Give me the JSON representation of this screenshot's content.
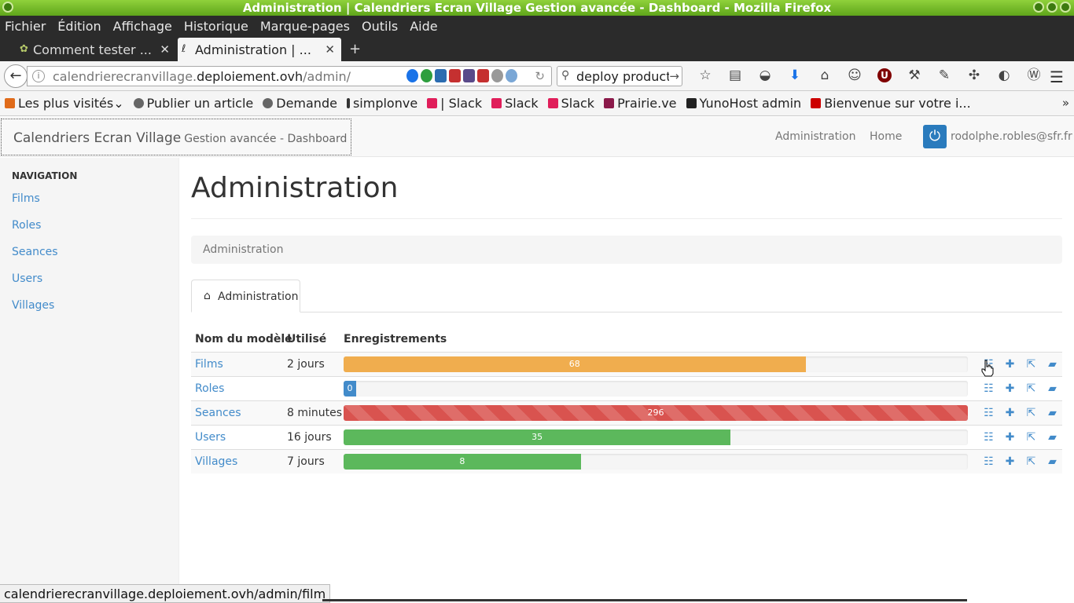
{
  "window": {
    "title": "Administration | Calendriers Ecran Village Gestion avancée - Dashboard - Mozilla Firefox"
  },
  "menu": [
    "Fichier",
    "Édition",
    "Affichage",
    "Historique",
    "Marque-pages",
    "Outils",
    "Aide"
  ],
  "tabs": [
    {
      "label": "Comment tester ...",
      "active": false
    },
    {
      "label": "Administration | ...",
      "active": true
    }
  ],
  "navbar": {
    "url_host_prefix": "calendrierecranvillage.",
    "url_domain": "deploiement.ovh",
    "url_path": "/admin/",
    "search_value": "deploy product"
  },
  "bookmarks": [
    {
      "label": "Les plus visités",
      "color": "#e06b1a"
    },
    {
      "label": "Publier un article",
      "color": "#666666"
    },
    {
      "label": "Demande",
      "color": "#666666"
    },
    {
      "label": "simplonve",
      "color": "#333333"
    },
    {
      "label": "| Slack",
      "color": "#e01e5a"
    },
    {
      "label": "Slack",
      "color": "#e01e5a"
    },
    {
      "label": "Slack",
      "color": "#e01e5a"
    },
    {
      "label": "Prairie.ve",
      "color": "#8b1a4a"
    },
    {
      "label": "YunoHost admin",
      "color": "#222222"
    },
    {
      "label": "Bienvenue sur votre i...",
      "color": "#cc0000"
    }
  ],
  "app": {
    "brand": "Calendriers Ecran Village",
    "brand_sub": "Gestion avancée - Dashboard",
    "header_links": [
      "Administration",
      "Home"
    ],
    "user_email": "rodolphe.robles@sfr.fr"
  },
  "sidebar": {
    "header": "NAVIGATION",
    "items": [
      "Films",
      "Roles",
      "Seances",
      "Users",
      "Villages"
    ]
  },
  "main": {
    "title": "Administration",
    "breadcrumb": "Administration",
    "tab_label": "Administration",
    "columns": [
      "Nom du modèle",
      "Utilisé",
      "Enregistrements"
    ],
    "rows": [
      {
        "name": "Films",
        "used": "2 jours",
        "count": "68",
        "fill_percent": 74,
        "color": "orange"
      },
      {
        "name": "Roles",
        "used": "",
        "count": "0",
        "fill_percent": 2,
        "color": "blue"
      },
      {
        "name": "Seances",
        "used": "8 minutes",
        "count": "296",
        "fill_percent": 100,
        "color": "red"
      },
      {
        "name": "Users",
        "used": "16 jours",
        "count": "35",
        "fill_percent": 62,
        "color": "green"
      },
      {
        "name": "Villages",
        "used": "7 jours",
        "count": "8",
        "fill_percent": 38,
        "color": "green"
      }
    ]
  },
  "status_bar": {
    "url_prefix": "calendrierecranvillage.",
    "url_rest": "deploiement.ovh/admin/film"
  },
  "colors": {
    "orange": "#f0ad4e",
    "blue": "#428bca",
    "red": "#d9534f",
    "green": "#5cb85c",
    "link": "#428bca"
  }
}
